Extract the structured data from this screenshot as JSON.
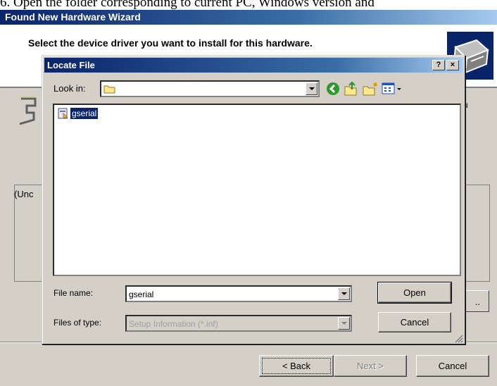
{
  "caption": "6. Open the folder corresponding to current PC, Windows version and",
  "wizard": {
    "title": "Found New Hardware Wizard",
    "heading": "Select the device driver you want to install for this hardware.",
    "hint_fragment": "u",
    "group_label_fragment": "(Unc",
    "side_button_fragment": "..",
    "buttons": {
      "back": "< Back",
      "next": "Next >",
      "cancel": "Cancel"
    }
  },
  "dialog": {
    "title": "Locate File",
    "help": "?",
    "close": "×",
    "look_in_label": "Look in:",
    "look_in_value": "",
    "files": [
      {
        "name": "gserial",
        "icon": "inf-file-icon"
      }
    ],
    "file_name_label": "File name:",
    "file_name_value": "gserial",
    "file_type_label": "Files of type:",
    "file_type_value": "Setup Information (*.inf)",
    "open_label": "Open",
    "cancel_label": "Cancel"
  },
  "colors": {
    "title_bar": "#0a246a",
    "face": "#d4d0c8",
    "selection": "#0a246a"
  }
}
